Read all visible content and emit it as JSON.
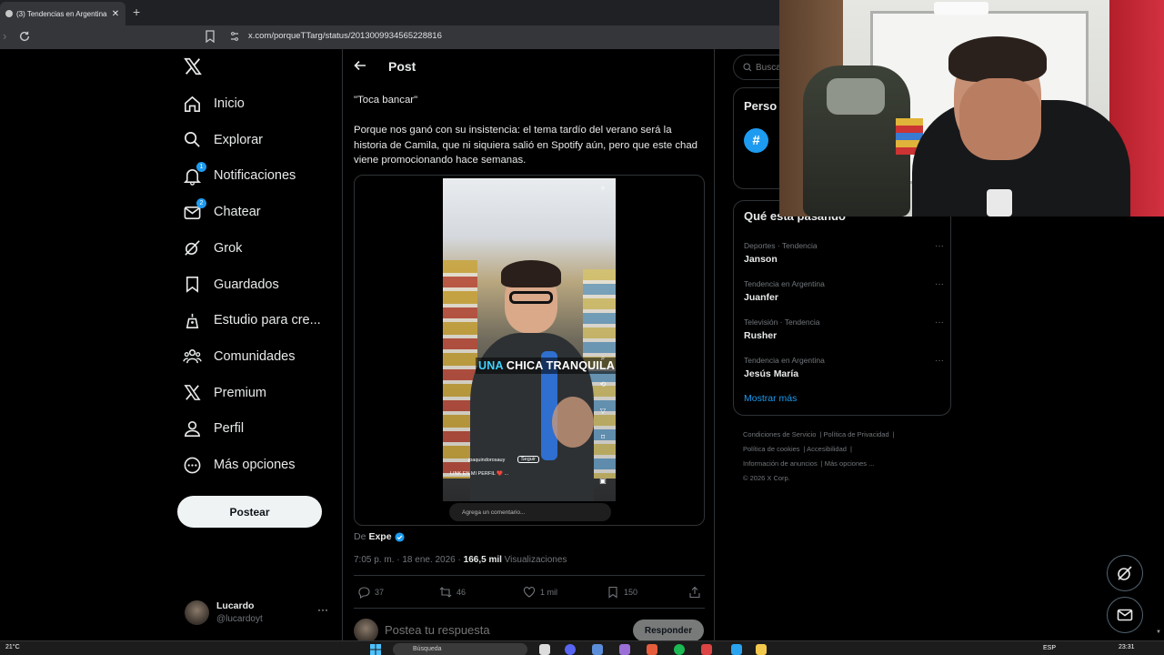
{
  "browser": {
    "tab_title": "(3) Tendencias en Argentina e",
    "url": "x.com/porqueTTarg/status/2013009934565228816"
  },
  "sidebar": {
    "items": [
      {
        "label": "Inicio",
        "icon": "home-icon"
      },
      {
        "label": "Explorar",
        "icon": "search-icon"
      },
      {
        "label": "Notificaciones",
        "icon": "bell-icon",
        "badge": "1"
      },
      {
        "label": "Chatear",
        "icon": "mail-icon",
        "badge": "2"
      },
      {
        "label": "Grok",
        "icon": "grok-icon"
      },
      {
        "label": "Guardados",
        "icon": "bookmark-icon"
      },
      {
        "label": "Estudio para cre...",
        "icon": "studio-icon"
      },
      {
        "label": "Comunidades",
        "icon": "communities-icon"
      },
      {
        "label": "Premium",
        "icon": "x-logo-icon"
      },
      {
        "label": "Perfil",
        "icon": "person-icon"
      },
      {
        "label": "Más opciones",
        "icon": "more-circle-icon"
      }
    ],
    "post_button": "Postear",
    "account": {
      "name": "Lucardo",
      "handle": "@lucardoyt"
    }
  },
  "post": {
    "header_title": "Post",
    "text_quote": "\"Toca bancar\"",
    "text_body": "Porque nos ganó con su insistencia: el tema tardío del verano será la historia de Camila, que ni siquiera salió en Spotify aún, pero que este chad viene promocionando hace semanas.",
    "video": {
      "caption_highlight": "UNA",
      "caption_rest": " CHICA TRANQUILA",
      "username": "joaquindorosauy",
      "follow": "Seguir",
      "bio": "LINK EN MI PERFIL ❤️ ...",
      "comment_placeholder": "Agrega un comentario..."
    },
    "source_prefix": "De",
    "source_name": "Expe",
    "time": "7:05 p. m. · 18 ene. 2026 · ",
    "views_count": "166,5 mil",
    "views_label": " Visualizaciones",
    "actions": {
      "replies": "37",
      "reposts": "46",
      "likes": "1 mil",
      "bookmarks": "150"
    },
    "reply_placeholder": "Postea tu respuesta",
    "reply_button": "Responder"
  },
  "right": {
    "search_placeholder": "Buscar",
    "card1_title": "Perso",
    "trends_title": "Qué está pasando",
    "trends": [
      {
        "context": "Deportes · Tendencia",
        "name": "Janson"
      },
      {
        "context": "Tendencia en Argentina",
        "name": "Juanfer"
      },
      {
        "context": "Televisión · Tendencia",
        "name": "Rusher"
      },
      {
        "context": "Tendencia en Argentina",
        "name": "Jesús María"
      }
    ],
    "show_more": "Mostrar más",
    "footer": {
      "terms": "Condiciones de Servicio",
      "privacy": "Política de Privacidad",
      "cookies": "Política de cookies",
      "accessibility": "Accesibilidad",
      "ads": "Información de anuncios",
      "more": "Más opciones ...",
      "copyright": "© 2026 X Corp."
    }
  },
  "taskbar": {
    "weather": "21°C",
    "search": "Búsqueda",
    "lang": "ESP",
    "time": "23:31"
  },
  "colors": {
    "accent": "#1d9bf0",
    "background": "#000000",
    "muted": "#71767b"
  }
}
